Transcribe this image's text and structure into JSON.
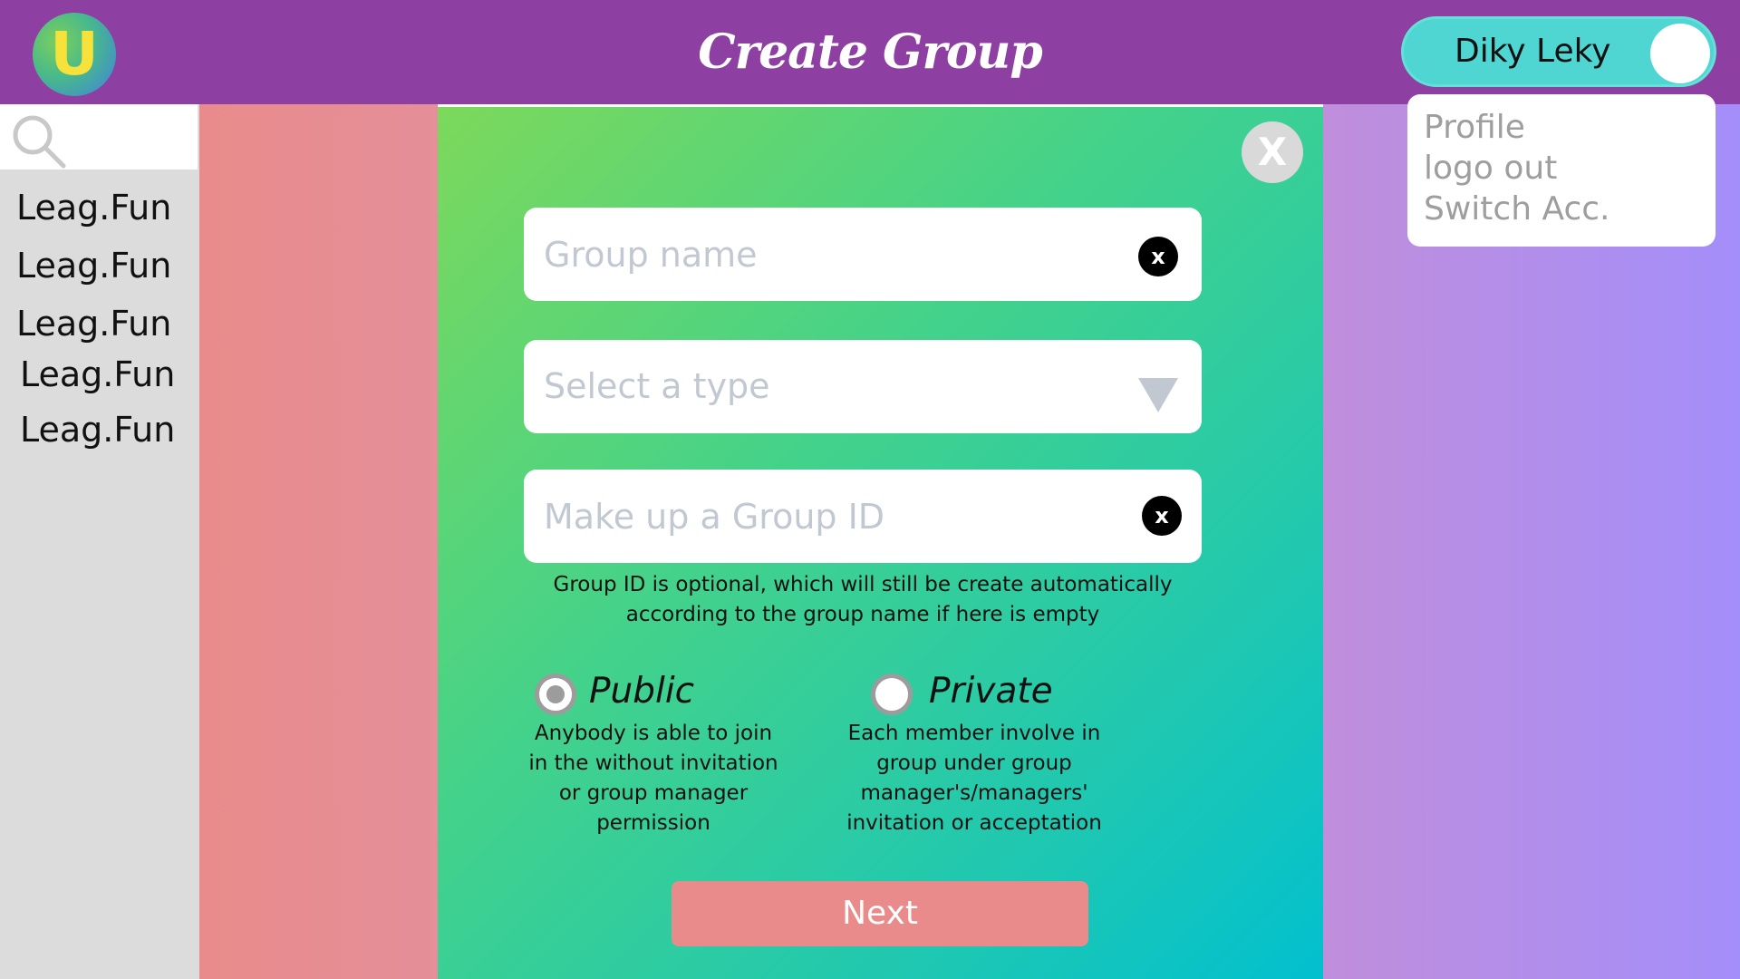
{
  "header": {
    "logo_letter": "U",
    "title": "Create Group",
    "user_name": "Diky Leky"
  },
  "user_menu": {
    "items": [
      "Profile",
      "logo out",
      "Switch Acc."
    ]
  },
  "sidebar": {
    "items": [
      "Leag.Fun",
      "Leag.Fun",
      "Leag.Fun",
      "Leag.Fun",
      "Leag.Fun"
    ]
  },
  "dialog": {
    "close_label": "X",
    "group_name": {
      "placeholder": "Group name",
      "clear_label": "x"
    },
    "type_select": {
      "placeholder": "Select a type"
    },
    "group_id": {
      "placeholder": "Make up a Group ID",
      "clear_label": "x"
    },
    "group_id_hint": "Group ID is optional, which will still be create automatically according to the group name if here is empty",
    "visibility": {
      "selected": "Public",
      "options": [
        {
          "label": "Public",
          "description": "Anybody is able to join in the without invitation or group manager permission"
        },
        {
          "label": "Private",
          "description": "Each member involve in group under group manager's/managers' invitation or acceptation"
        }
      ]
    },
    "next_label": "Next"
  },
  "colors": {
    "header_bg": "#8d40a2",
    "pill_bg": "#4fd6d2",
    "sidebar_bg": "#dcdcdc",
    "left_panel": "#e98b8b",
    "right_panel": "#a48efa",
    "dialog_gradient_start": "#7cd95b",
    "dialog_gradient_end": "#02c0cf",
    "next_button": "#e98b8b"
  },
  "icons": [
    "search-icon",
    "close-icon",
    "clear-icon",
    "chevron-down-icon",
    "logo-icon"
  ]
}
